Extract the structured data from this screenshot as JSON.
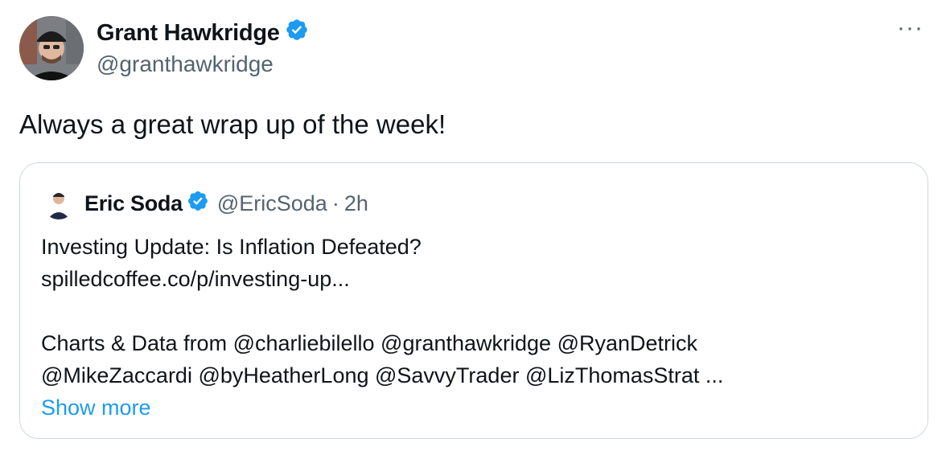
{
  "author": {
    "name": "Grant Hawkridge",
    "handle": "@granthawkridge",
    "verified_color": "#1d9bf0",
    "icon": "verified-badge-icon"
  },
  "more_label": "···",
  "tweet": {
    "text": "Always a great wrap up of the week!"
  },
  "quoted": {
    "name": "Eric Soda",
    "handle": "@EricSoda",
    "separator": "·",
    "time": "2h",
    "lines": [
      "Investing Update: Is Inflation Defeated?",
      "spilledcoffee.co/p/investing-up...",
      "",
      "Charts & Data from @charliebilello @granthawkridge @RyanDetrick",
      "@MikeZaccardi @byHeatherLong @SavvyTrader @LizThomasStrat ..."
    ],
    "show_more": "Show more"
  },
  "colors": {
    "text": "#0f1419",
    "muted": "#536471",
    "link": "#1d9bf0",
    "border": "#cfd9de"
  }
}
